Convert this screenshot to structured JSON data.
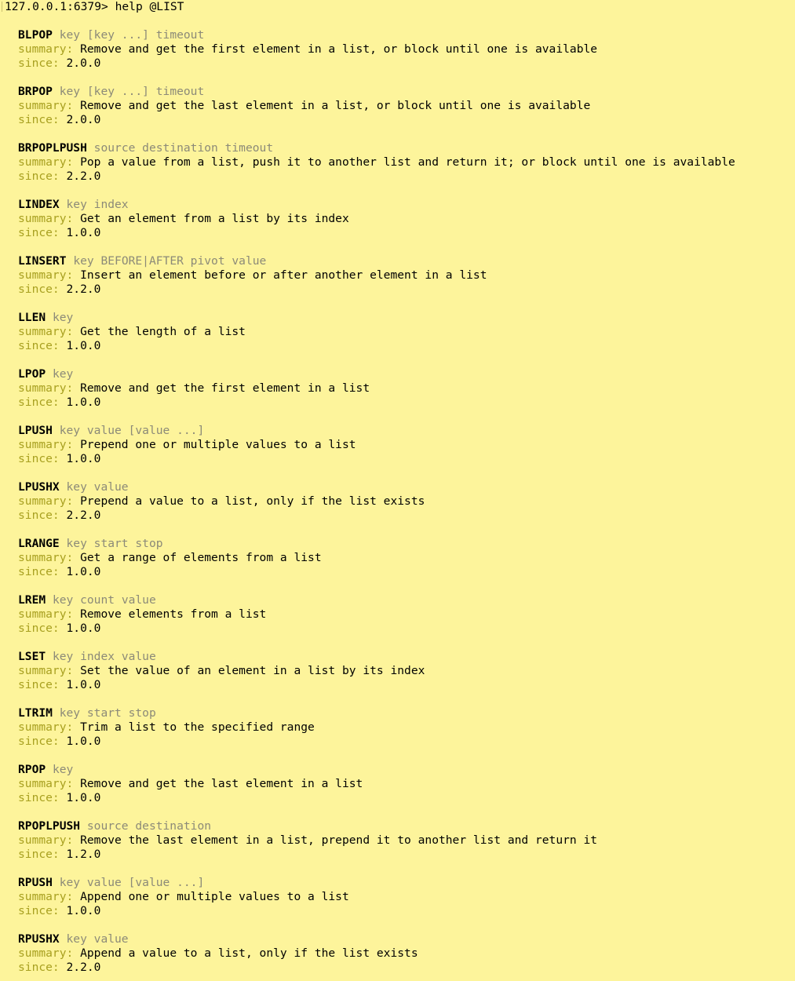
{
  "prompt": {
    "host": "127.0.0.1:6379>",
    "command": "help @LIST"
  },
  "labels": {
    "summary": "summary:",
    "since": "since:"
  },
  "colors": {
    "background": "#fdf49b",
    "label": "#a8a020",
    "args": "#8c8a78",
    "text": "#000000"
  },
  "commands": [
    {
      "name": "BLPOP",
      "args": "key [key ...] timeout",
      "summary": "Remove and get the first element in a list, or block until one is available",
      "since": "2.0.0"
    },
    {
      "name": "BRPOP",
      "args": "key [key ...] timeout",
      "summary": "Remove and get the last element in a list, or block until one is available",
      "since": "2.0.0"
    },
    {
      "name": "BRPOPLPUSH",
      "args": "source destination timeout",
      "summary": "Pop a value from a list, push it to another list and return it; or block until one is available",
      "since": "2.2.0"
    },
    {
      "name": "LINDEX",
      "args": "key index",
      "summary": "Get an element from a list by its index",
      "since": "1.0.0"
    },
    {
      "name": "LINSERT",
      "args": "key BEFORE|AFTER pivot value",
      "summary": "Insert an element before or after another element in a list",
      "since": "2.2.0"
    },
    {
      "name": "LLEN",
      "args": "key",
      "summary": "Get the length of a list",
      "since": "1.0.0"
    },
    {
      "name": "LPOP",
      "args": "key",
      "summary": "Remove and get the first element in a list",
      "since": "1.0.0"
    },
    {
      "name": "LPUSH",
      "args": "key value [value ...]",
      "summary": "Prepend one or multiple values to a list",
      "since": "1.0.0"
    },
    {
      "name": "LPUSHX",
      "args": "key value",
      "summary": "Prepend a value to a list, only if the list exists",
      "since": "2.2.0"
    },
    {
      "name": "LRANGE",
      "args": "key start stop",
      "summary": "Get a range of elements from a list",
      "since": "1.0.0"
    },
    {
      "name": "LREM",
      "args": "key count value",
      "summary": "Remove elements from a list",
      "since": "1.0.0"
    },
    {
      "name": "LSET",
      "args": "key index value",
      "summary": "Set the value of an element in a list by its index",
      "since": "1.0.0"
    },
    {
      "name": "LTRIM",
      "args": "key start stop",
      "summary": "Trim a list to the specified range",
      "since": "1.0.0"
    },
    {
      "name": "RPOP",
      "args": "key",
      "summary": "Remove and get the last element in a list",
      "since": "1.0.0"
    },
    {
      "name": "RPOPLPUSH",
      "args": "source destination",
      "summary": "Remove the last element in a list, prepend it to another list and return it",
      "since": "1.2.0"
    },
    {
      "name": "RPUSH",
      "args": "key value [value ...]",
      "summary": "Append one or multiple values to a list",
      "since": "1.0.0"
    },
    {
      "name": "RPUSHX",
      "args": "key value",
      "summary": "Append a value to a list, only if the list exists",
      "since": "2.2.0"
    }
  ]
}
